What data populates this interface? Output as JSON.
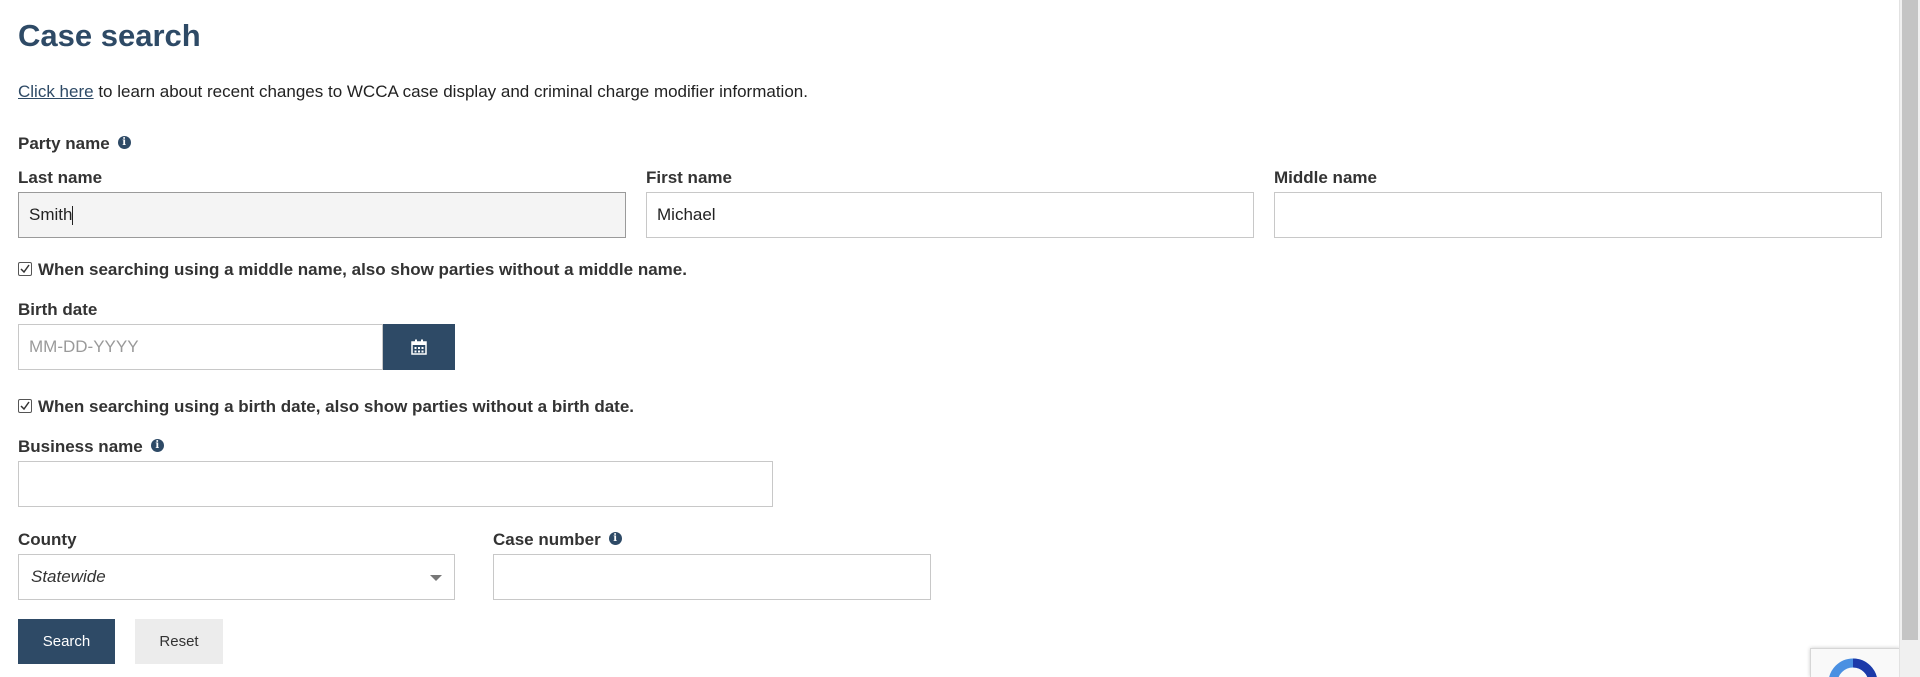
{
  "page": {
    "title": "Case search",
    "intro_link": "Click here",
    "intro_text": " to learn about recent changes to WCCA case display and criminal charge modifier information."
  },
  "party": {
    "section_label": "Party name",
    "last_name_label": "Last name",
    "last_name_value": "Smith",
    "first_name_label": "First name",
    "first_name_value": "Michael",
    "middle_name_label": "Middle name",
    "middle_name_value": "",
    "middle_checkbox_label": "When searching using a middle name, also show parties without a middle name.",
    "middle_checkbox_checked": true
  },
  "birth": {
    "label": "Birth date",
    "placeholder": "MM-DD-YYYY",
    "checkbox_label": "When searching using a birth date, also show parties without a birth date.",
    "checkbox_checked": true
  },
  "business": {
    "label": "Business name",
    "value": ""
  },
  "county": {
    "label": "County",
    "selected": "Statewide"
  },
  "case_number": {
    "label": "Case number",
    "value": ""
  },
  "buttons": {
    "search": "Search",
    "reset": "Reset"
  },
  "icons": {
    "info": "info-icon",
    "calendar": "calendar-icon",
    "checkmark": "checkmark-icon",
    "dropdown": "chevron-down-icon",
    "recaptcha": "recaptcha-icon"
  },
  "colors": {
    "brand": "#2e4a66",
    "secondary_button": "#ececec"
  }
}
